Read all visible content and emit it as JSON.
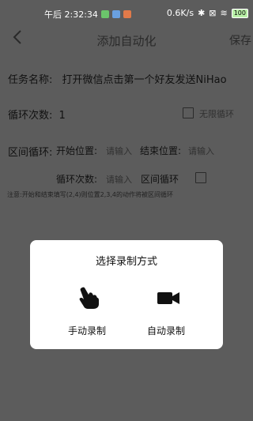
{
  "status_bar": {
    "time": "午后 2:32:34",
    "network_speed": "0.6K/s",
    "battery": "100"
  },
  "app_bar": {
    "back_icon": "chevron-left-icon",
    "title": "添加自动化",
    "save_label": "保存"
  },
  "form": {
    "task_name_label": "任务名称:",
    "task_name_value": "打开微信点击第一个好友发送NiHao",
    "loop_count_label": "循环次数:",
    "loop_count_value": "1",
    "infinite_loop_label": "无限循环",
    "range_loop_label": "区间循环:",
    "start_label": "开始位置:",
    "start_placeholder": "请输入",
    "end_label": "结束位置:",
    "end_placeholder": "请输入",
    "range_loop_count_label": "循环次数:",
    "range_loop_count_placeholder": "请输入",
    "range_loop_toggle_label": "区间循环",
    "note": "注意:开始和结束填写(2,4)则位置2,3,4的动作将被区间循环"
  },
  "dialog": {
    "title": "选择录制方式",
    "options": [
      {
        "label": "手动录制",
        "icon": "hand-pointer-icon"
      },
      {
        "label": "自动录制",
        "icon": "video-camera-icon"
      }
    ]
  }
}
